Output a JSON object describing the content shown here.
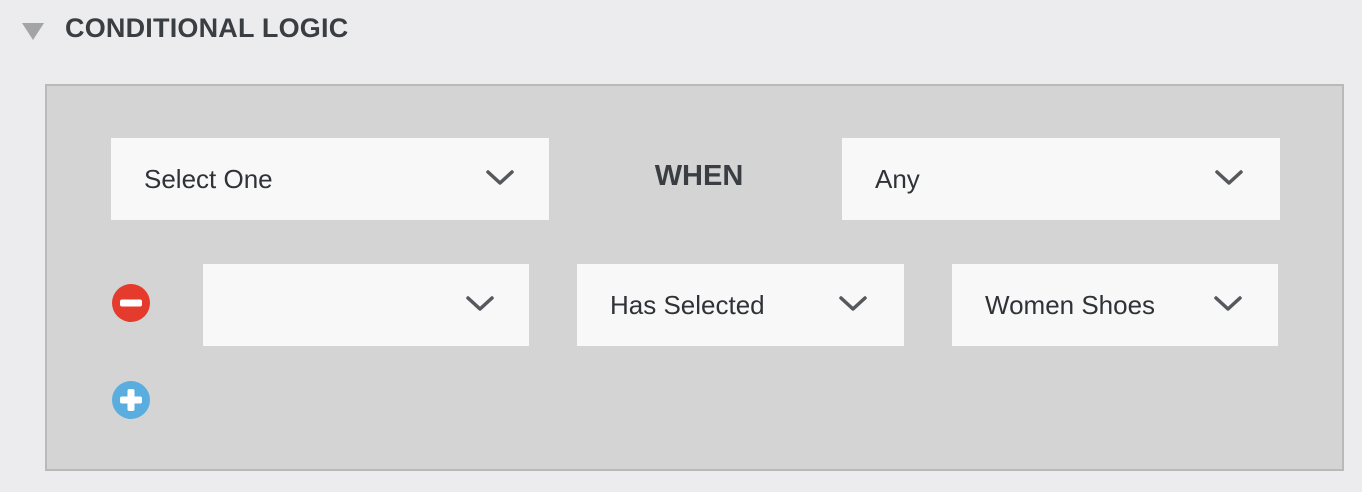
{
  "section": {
    "title": "CONDITIONAL LOGIC",
    "toggle_icon": "triangle-down-icon"
  },
  "rule_header": {
    "action_select": {
      "value": "Select One",
      "icon": "chevron-down-icon"
    },
    "when_label": "WHEN",
    "match_select": {
      "value": "Any",
      "icon": "chevron-down-icon"
    }
  },
  "conditions": [
    {
      "field_select": {
        "value": ""
      },
      "operator_select": {
        "value": "Has Selected"
      },
      "value_select": {
        "value": "Women Shoes"
      },
      "remove_icon": "minus-circle-icon"
    }
  ],
  "add_icon": "plus-circle-icon",
  "colors": {
    "remove": "#e43b2c",
    "add": "#5aaedf",
    "panel": "#d4d4d4",
    "background": "#ececee"
  }
}
